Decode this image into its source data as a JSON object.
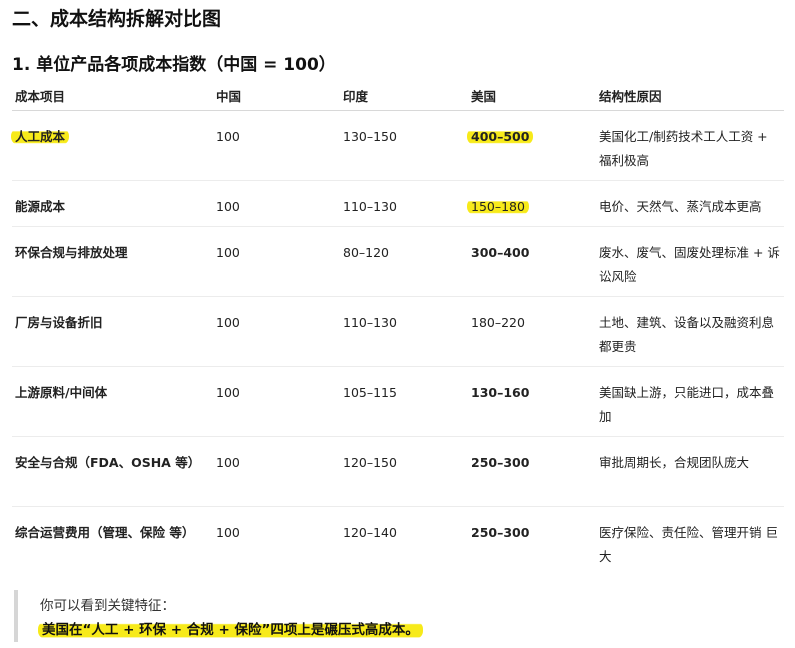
{
  "section_title": "二、成本结构拆解对比图",
  "subsection_title": "1. 单位产品各项成本指数（中国 = 100）",
  "table": {
    "headers": [
      "成本项目",
      "中国",
      "印度",
      "美国",
      "结构性原因"
    ],
    "rows": [
      {
        "item": "人工成本",
        "china": "100",
        "india": "130–150",
        "usa": "400–500",
        "reason": "美国化工/制药技术工人工资 + 福利极高",
        "item_highlight": true,
        "usa_highlight": true,
        "usa_bold": true
      },
      {
        "item": "能源成本",
        "china": "100",
        "india": "110–130",
        "usa": "150–180",
        "reason": "电价、天然气、蒸汽成本更高",
        "item_highlight": false,
        "usa_highlight": true,
        "usa_bold": false
      },
      {
        "item": "环保合规与排放处理",
        "china": "100",
        "india": "80–120",
        "usa": "300–400",
        "reason": "废水、废气、固废处理标准 + 诉讼风险",
        "item_highlight": false,
        "usa_highlight": false,
        "usa_bold": true
      },
      {
        "item": "厂房与设备折旧",
        "china": "100",
        "india": "110–130",
        "usa": "180–220",
        "reason": "土地、建筑、设备以及融资利息都更贵",
        "item_highlight": false,
        "usa_highlight": false,
        "usa_bold": false
      },
      {
        "item": "上游原料/中间体",
        "china": "100",
        "india": "105–115",
        "usa": "130–160",
        "reason": "美国缺上游，只能进口，成本叠加",
        "item_highlight": false,
        "usa_highlight": false,
        "usa_bold": true
      },
      {
        "item": "安全与合规（FDA、OSHA 等）",
        "china": "100",
        "india": "120–150",
        "usa": "250–300",
        "reason": "审批周期长，合规团队庞大",
        "item_highlight": false,
        "usa_highlight": false,
        "usa_bold": true
      },
      {
        "item": "综合运营费用（管理、保险 等）",
        "china": "100",
        "india": "120–140",
        "usa": "250–300",
        "reason": "医疗保险、责任险、管理开销 巨大",
        "item_highlight": false,
        "usa_highlight": false,
        "usa_bold": true
      }
    ]
  },
  "quote": {
    "line1": "你可以看到关键特征：",
    "line2": "美国在“人工 + 环保 + 合规 + 保险”四项上是碾压式高成本。"
  },
  "colors": {
    "highlight": "#f7ea1a",
    "quote_bar": "#d6d6d6",
    "header_rule": "#d8d8d8",
    "row_rule": "#ececec"
  }
}
